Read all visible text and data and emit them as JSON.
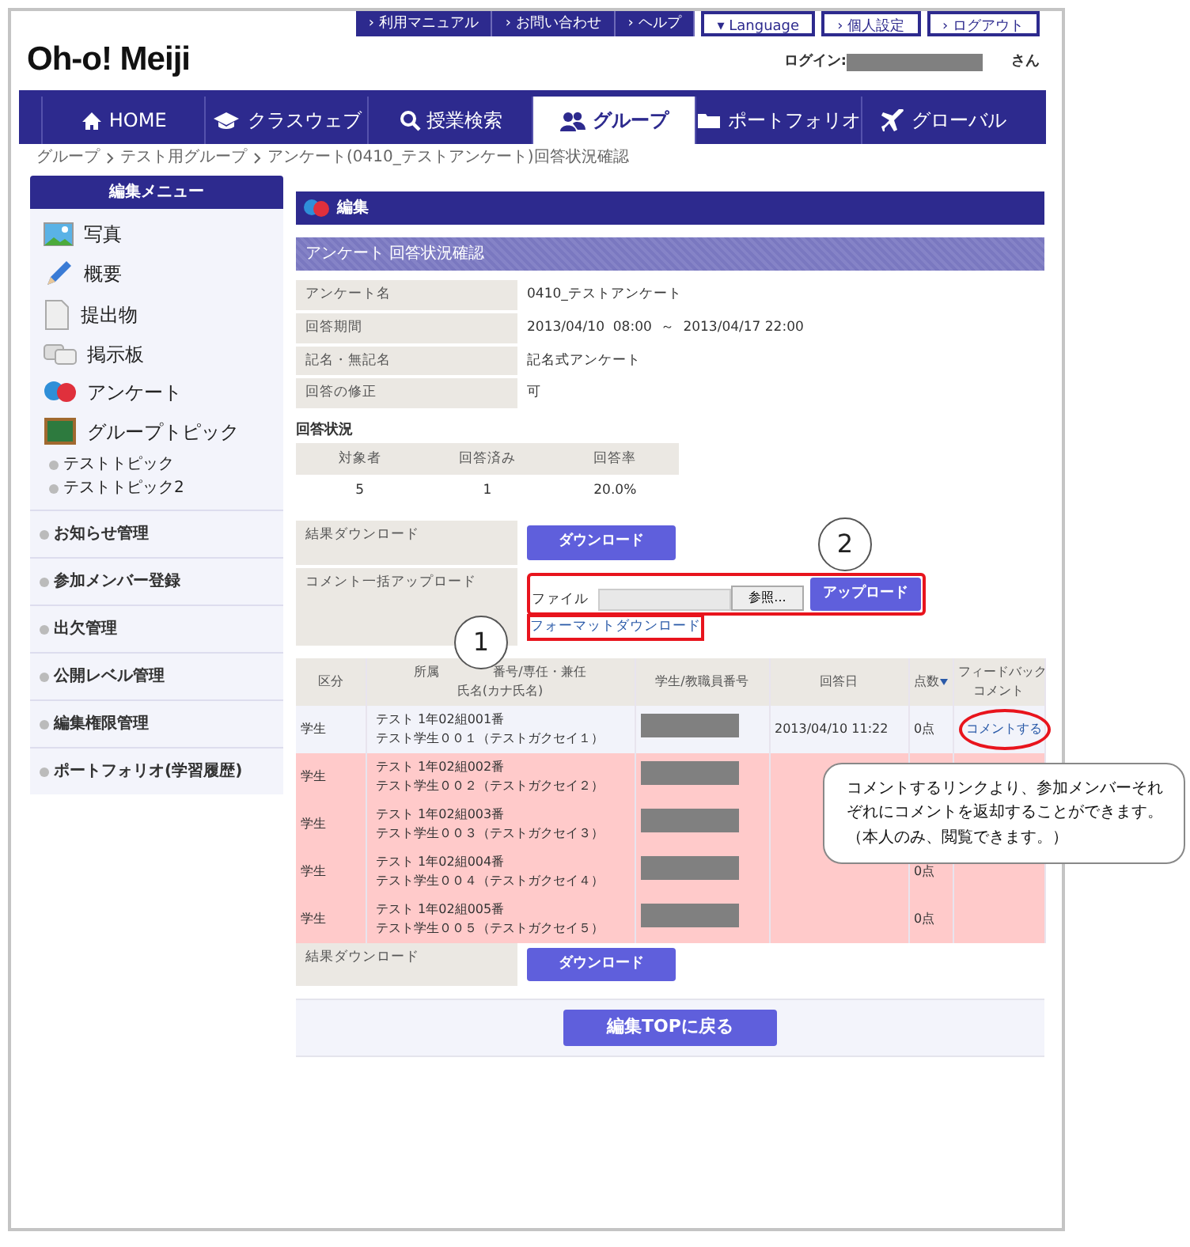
{
  "header": {
    "logo": "Oh-o! Meiji",
    "top_links": [
      {
        "label": "› 利用マニュアル",
        "kind": "dark"
      },
      {
        "label": "› お問い合わせ",
        "kind": "dark"
      },
      {
        "label": "› ヘルプ",
        "kind": "dark"
      },
      {
        "label": "▾ Language",
        "kind": "light"
      },
      {
        "label": "› 個人設定",
        "kind": "light"
      },
      {
        "label": "› ログアウト",
        "kind": "light"
      }
    ],
    "login_label": "ログイン:",
    "login_suffix": "さん"
  },
  "nav": [
    {
      "label": "HOME",
      "selected": false
    },
    {
      "label": "クラスウェブ",
      "selected": false
    },
    {
      "label": "授業検索",
      "selected": false
    },
    {
      "label": "グループ",
      "selected": true
    },
    {
      "label": "ポートフォリオ",
      "selected": false
    },
    {
      "label": "グローバル",
      "selected": false
    }
  ],
  "breadcrumb": [
    "グループ",
    "テスト用グループ",
    "アンケート(0410_テストアンケート)回答状況確認"
  ],
  "sidebar": {
    "title": "編集メニュー",
    "items": [
      "写真",
      "概要",
      "提出物",
      "掲示板",
      "アンケート",
      "グループトピック"
    ],
    "topics": [
      "テストトピック",
      "テストトピック2"
    ],
    "menu": [
      "お知らせ管理",
      "参加メンバー登録",
      "出欠管理",
      "公開レベル管理",
      "編集権限管理",
      "ポートフォリオ(学習履歴)"
    ]
  },
  "main": {
    "title": "編集",
    "section": "アンケート 回答状況確認",
    "info": [
      {
        "label": "アンケート名",
        "value": "0410_テストアンケート"
      },
      {
        "label": "回答期間",
        "value": "2013/04/10  08:00  ～  2013/04/17 22:00"
      },
      {
        "label": "記名・無記名",
        "value": "記名式アンケート"
      },
      {
        "label": "回答の修正",
        "value": "可"
      }
    ],
    "status_title": "回答状況",
    "status": {
      "columns": [
        "対象者",
        "回答済み",
        "回答率"
      ],
      "values": [
        "5",
        "1",
        "20.0%"
      ]
    },
    "download_label": "結果ダウンロード",
    "download_button": "ダウンロード",
    "upload_label": "コメント一括アップロード",
    "file_label": "ファイル",
    "browse_button": "参照...",
    "upload_button": "アップロード",
    "format_link": "フォーマットダウンロード",
    "table": {
      "columns": [
        [
          "区分"
        ],
        [
          "所属",
          "番号/専任・兼任",
          "氏名(カナ氏名)"
        ],
        [
          "学生/教職員番号"
        ],
        [
          "回答日"
        ],
        [
          "点数"
        ],
        [
          "フィードバック",
          "コメント"
        ]
      ],
      "rows": [
        {
          "category": "学生",
          "affiliation": "テスト 1年02組001番",
          "name": "テスト学生００１（テストガクセイ１）",
          "date": "2013/04/10 11:22",
          "score": "0点",
          "comment": "コメントする",
          "answered": true
        },
        {
          "category": "学生",
          "affiliation": "テスト 1年02組002番",
          "name": "テスト学生００２（テストガクセイ２）",
          "answered": false
        },
        {
          "category": "学生",
          "affiliation": "テスト 1年02組003番",
          "name": "テスト学生００３（テストガクセイ３）",
          "answered": false
        },
        {
          "category": "学生",
          "affiliation": "テスト 1年02組004番",
          "name": "テスト学生００４（テストガクセイ４）",
          "score": "0点",
          "answered": false
        },
        {
          "category": "学生",
          "affiliation": "テスト 1年02組005番",
          "name": "テスト学生００５（テストガクセイ５）",
          "score": "0点",
          "answered": false
        }
      ]
    },
    "bottom_download_label": "結果ダウンロード",
    "bottom_download_button": "ダウンロード",
    "back_button": "編集TOPに戻る"
  },
  "annotations": {
    "markers": [
      "1",
      "2"
    ],
    "callout": "コメントするリンクより、参加メンバーそれぞれにコメントを返却することができます。（本人のみ、閲覧できます。）"
  }
}
